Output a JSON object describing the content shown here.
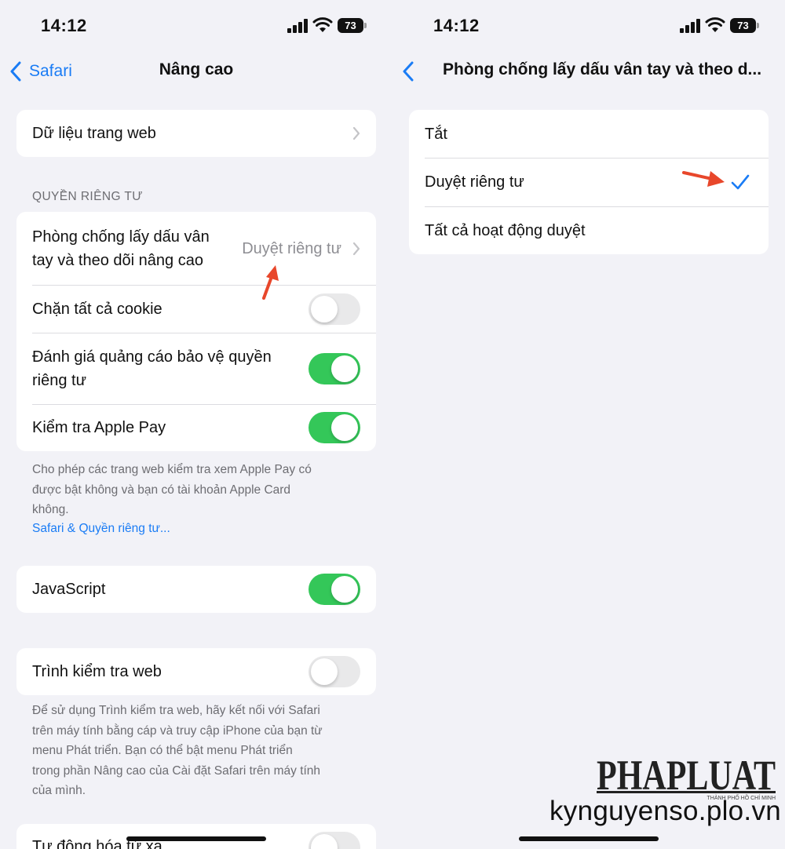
{
  "left": {
    "status": {
      "time": "14:12",
      "battery": "73"
    },
    "nav": {
      "back_label": "Safari",
      "title": "Nâng cao"
    },
    "website_data": {
      "label": "Dữ liệu trang web"
    },
    "privacy_header": "QUYỀN RIÊNG TƯ",
    "privacy_rows": {
      "fingerprint": {
        "label_line1": "Phòng chống lấy dấu vân",
        "label_line2": "tay và theo dõi nâng cao",
        "value": "Duyệt riêng tư"
      },
      "block_cookies": {
        "label": "Chặn tất cả cookie",
        "on": false
      },
      "ad_measurement": {
        "label_line1": "Đánh giá quảng cáo bảo vệ quyền",
        "label_line2": "riêng tư",
        "on": true
      },
      "apple_pay": {
        "label": "Kiểm tra Apple Pay",
        "on": true
      }
    },
    "apple_pay_footer": {
      "line1": "Cho phép các trang web kiểm tra xem Apple Pay có",
      "line2": "được bật không và bạn có tài khoản Apple Card",
      "line3": "không.",
      "link": "Safari & Quyền riêng tư..."
    },
    "javascript": {
      "label": "JavaScript",
      "on": true
    },
    "web_inspector": {
      "label": "Trình kiểm tra web",
      "on": false
    },
    "web_inspector_footer": {
      "line1": "Để sử dụng Trình kiểm tra web, hãy kết nối với Safari",
      "line2": "trên máy tính bằng cáp và truy cập iPhone của bạn từ",
      "line3": "menu Phát triển. Bạn có thể bật menu Phát triển",
      "line4": "trong phần Nâng cao của Cài đặt Safari trên máy tính",
      "line5": "của mình."
    },
    "remote_automation": {
      "label": "Tự động hóa từ xa",
      "on": false
    }
  },
  "right": {
    "status": {
      "time": "14:12",
      "battery": "73"
    },
    "nav": {
      "title": "Phòng chống lấy dấu vân tay và theo d..."
    },
    "options": [
      {
        "label": "Tắt",
        "selected": false
      },
      {
        "label": "Duyệt riêng tư",
        "selected": true
      },
      {
        "label": "Tất cả hoạt động duyệt",
        "selected": false
      }
    ]
  },
  "watermark": {
    "brand": "PHAPLUAT",
    "tagline": "THÀNH PHỐ HỒ CHÍ MINH",
    "url": "kynguyenso.plo.vn"
  },
  "colors": {
    "accent": "#1a7cf5",
    "toggle_on": "#34c759",
    "toggle_off": "#e9e9ea",
    "annotation_arrow": "#e8472b",
    "background": "#f2f2f7"
  }
}
